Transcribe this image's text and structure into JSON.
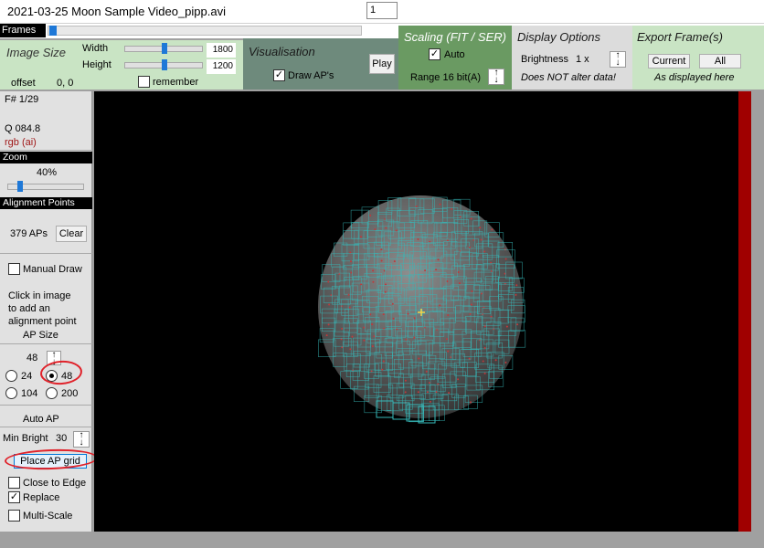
{
  "window": {
    "title": "2021-03-25 Moon Sample Video_pipp.avi"
  },
  "frames": {
    "label": "Frames",
    "current_value": "1"
  },
  "image_size": {
    "heading": "Image Size",
    "width_label": "Width",
    "width_value": "1800",
    "height_label": "Height",
    "height_value": "1200",
    "offset_label": "offset",
    "offset_value": "0, 0",
    "remember_label": "remember"
  },
  "visualisation": {
    "heading": "Visualisation",
    "draw_aps_label": "Draw AP's",
    "play_label": "Play"
  },
  "scaling": {
    "heading": "Scaling (FIT / SER)",
    "auto_label": "Auto",
    "range_label": "Range 16 bit(A)"
  },
  "display_options": {
    "heading": "Display Options",
    "brightness_label": "Brightness",
    "brightness_value": "1 x",
    "note": "Does NOT alter data!"
  },
  "export": {
    "heading": "Export Frame(s)",
    "current_label": "Current",
    "all_label": "All",
    "note": "As displayed here"
  },
  "info": {
    "frame": "F# 1/29",
    "quality": "Q  084.8",
    "mode": "rgb (ai)"
  },
  "zoom": {
    "heading": "Zoom",
    "value": "40%"
  },
  "alignment": {
    "heading": "Alignment Points",
    "count": "379 APs",
    "clear_label": "Clear",
    "manual_draw_label": "Manual Draw",
    "hint_line1": "Click in image",
    "hint_line2": "to add an",
    "hint_line3": "alignment point",
    "ap_size_label": "AP Size",
    "ap_size_value": "48",
    "sizes": [
      "24",
      "48",
      "104",
      "200"
    ],
    "auto_ap_label": "Auto AP",
    "min_bright_label": "Min Bright",
    "min_bright_value": "30",
    "place_grid_label": "Place AP grid",
    "close_to_edge_label": "Close to Edge",
    "replace_label": "Replace",
    "multi_scale_label": "Multi-Scale"
  },
  "colors": {
    "ap_box": "#36b8b8",
    "ap_point": "#c0393b",
    "annotation": "#e0222a",
    "accent": "#1e78d7"
  }
}
